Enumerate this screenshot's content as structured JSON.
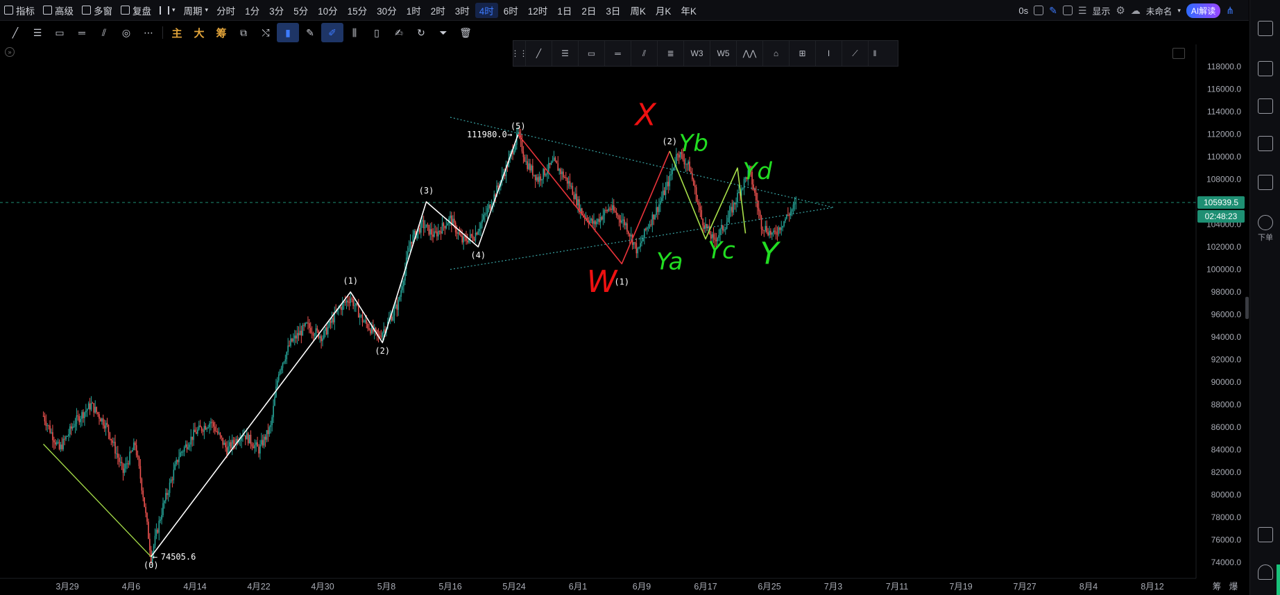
{
  "topbar": {
    "left_items": [
      {
        "name": "indicators",
        "label": "指标",
        "icon": "chart-icon"
      },
      {
        "name": "advanced",
        "label": "高级",
        "icon": "calendar-icon"
      },
      {
        "name": "multi-window",
        "label": "多窗",
        "icon": "grid-icon"
      },
      {
        "name": "replay",
        "label": "复盘",
        "icon": "rewind-icon"
      }
    ],
    "chart_type_icon": "candlestick-icon",
    "period_menu_label": "周期",
    "periods": [
      "分时",
      "1分",
      "3分",
      "5分",
      "10分",
      "15分",
      "30分",
      "1时",
      "2时",
      "3时",
      "4时",
      "6时",
      "12时",
      "1日",
      "2日",
      "3日",
      "周K",
      "月K",
      "年K"
    ],
    "active_period": "4时",
    "right": {
      "timer": "0s",
      "display_label": "显示",
      "layout_name": "未命名",
      "ai_label": "AI解读"
    }
  },
  "toolbar2": {
    "tools": [
      "line-tool-icon",
      "hlines-tool-icon",
      "rect-tool-icon",
      "ruler-tool-icon",
      "parallel-tool-icon",
      "fib-circle-tool-icon",
      "more-tools-icon"
    ],
    "indicator_buttons": [
      "主",
      "大",
      "筹"
    ],
    "extra_tools": [
      "overlay-icon",
      "erase-line-icon",
      "magnet-icon",
      "pencil-icon",
      "draw-active-icon",
      "compare-icon",
      "delete-lock-icon",
      "note-icon",
      "rotate-icon",
      "filter-icon",
      "trash-icon"
    ]
  },
  "floatbar": {
    "tools": [
      "grip-icon",
      "segment-icon",
      "hlines-icon",
      "rect-icon",
      "ruler-icon",
      "parallel-icon",
      "fib-icon",
      "wave3-icon",
      "wave5-icon",
      "peaks-icon",
      "shape-icon",
      "crosshair-icon",
      "text-cursor-icon",
      "pen-icon",
      "collapse-icon"
    ],
    "wave3_label": "W3",
    "wave5_label": "W5"
  },
  "sidebar": {
    "order_label": "下单"
  },
  "colors": {
    "up": "#26a69a",
    "down": "#ef5350",
    "white_wave": "#ffffff",
    "red_wave": "#e8333a",
    "green_wave": "#a8e04a",
    "price_tag": "#1e8f73",
    "annotation_green": "#22dd22",
    "annotation_red": "#ee1111"
  },
  "chart_data": {
    "type": "candlestick",
    "y_ticks": [
      "118000.0",
      "116000.0",
      "114000.0",
      "112000.0",
      "110000.0",
      "108000.0",
      "106000.0",
      "104000.0",
      "102000.0",
      "100000.0",
      "98000.0",
      "96000.0",
      "94000.0",
      "92000.0",
      "90000.0",
      "88000.0",
      "86000.0",
      "84000.0",
      "82000.0",
      "80000.0",
      "78000.0",
      "76000.0",
      "74000.0"
    ],
    "ylim": [
      73000,
      119000
    ],
    "x_ticks": [
      "3月29",
      "4月6",
      "4月14",
      "4月22",
      "4月30",
      "5月8",
      "5月16",
      "5月24",
      "6月1",
      "6月9",
      "6月17",
      "6月25",
      "7月3",
      "7月11",
      "7月19",
      "7月27",
      "8月4",
      "8月12"
    ],
    "x_tick_days": [
      0,
      8,
      16,
      24,
      32,
      40,
      48,
      56,
      64,
      72,
      80,
      88,
      96,
      104,
      112,
      120,
      128,
      136
    ],
    "last_price": "105939.5",
    "last_price_value": 105939.5,
    "countdown": "02:48:23",
    "bottom_right_labels": [
      "筹",
      "爆"
    ],
    "high_label": "111980.0",
    "low_label": "74505.6",
    "high_value": 111980.0,
    "low_value": 74505.6,
    "ohlc_keypoints_day_price": [
      [
        -3,
        87000
      ],
      [
        -1,
        84000
      ],
      [
        1,
        86500
      ],
      [
        3,
        88000
      ],
      [
        5,
        86000
      ],
      [
        7,
        82000
      ],
      [
        8.5,
        84500
      ],
      [
        9.5,
        80000
      ],
      [
        10.5,
        74505.6
      ],
      [
        12,
        79000
      ],
      [
        14,
        83500
      ],
      [
        16,
        85500
      ],
      [
        18,
        86500
      ],
      [
        20,
        84000
      ],
      [
        22,
        85500
      ],
      [
        24,
        84000
      ],
      [
        25.5,
        86000
      ],
      [
        26.5,
        91000
      ],
      [
        28,
        93500
      ],
      [
        30,
        95000
      ],
      [
        32,
        94000
      ],
      [
        34,
        96500
      ],
      [
        35.5,
        97500
      ],
      [
        37,
        95500
      ],
      [
        39,
        94000
      ],
      [
        40,
        95000
      ],
      [
        41.5,
        97000
      ],
      [
        43,
        102500
      ],
      [
        44.5,
        104000
      ],
      [
        46,
        103000
      ],
      [
        48,
        104500
      ],
      [
        49.5,
        102500
      ],
      [
        51,
        103000
      ],
      [
        52.5,
        105000
      ],
      [
        53.5,
        106500
      ],
      [
        55,
        109000
      ],
      [
        56.5,
        111980
      ],
      [
        57.5,
        109500
      ],
      [
        59,
        108000
      ],
      [
        61,
        109500
      ],
      [
        63,
        107500
      ],
      [
        64.5,
        105000
      ],
      [
        66,
        104000
      ],
      [
        68,
        105500
      ],
      [
        70,
        104000
      ],
      [
        71.5,
        101500
      ],
      [
        72.5,
        103500
      ],
      [
        74,
        105500
      ],
      [
        75.5,
        108000
      ],
      [
        76.5,
        110500
      ],
      [
        78,
        109000
      ],
      [
        79.5,
        104500
      ],
      [
        81,
        102500
      ],
      [
        82.5,
        104000
      ],
      [
        84,
        106500
      ],
      [
        85.5,
        108800
      ],
      [
        87,
        104000
      ],
      [
        88.5,
        103000
      ],
      [
        90,
        104500
      ],
      [
        91.5,
        105939.5
      ]
    ],
    "white_wave_points_day_price": [
      [
        10.5,
        74505.6
      ],
      [
        35.5,
        98000
      ],
      [
        39.5,
        93500
      ],
      [
        45,
        106000
      ],
      [
        51.5,
        102000
      ],
      [
        56.5,
        111980
      ]
    ],
    "white_wave_labels": [
      "(0)",
      "(1)",
      "(2)",
      "(3)",
      "(4)",
      "(5)"
    ],
    "red_wave_points_day_price": [
      [
        56.5,
        111980
      ],
      [
        69.5,
        100500
      ],
      [
        75.5,
        110500
      ]
    ],
    "red_wave_labels": [
      "(5)",
      "(1)",
      "(2)"
    ],
    "green_wave_points_day_price": [
      [
        75.5,
        110500
      ],
      [
        80,
        102700
      ],
      [
        84,
        109000
      ],
      [
        85,
        103200
      ]
    ],
    "green_line_left_points_day_price": [
      [
        -3,
        84500
      ],
      [
        10.5,
        74505.6
      ]
    ],
    "triangle_upper_points_day_price": [
      [
        48,
        113500
      ],
      [
        96,
        105500
      ]
    ],
    "triangle_lower_points_day_price": [
      [
        48,
        100000
      ],
      [
        96,
        105500
      ]
    ],
    "annotations": [
      {
        "text": "X",
        "color": "red",
        "day": 72.5,
        "price": 112800
      },
      {
        "text": "W",
        "color": "red",
        "day": 67,
        "price": 98000
      },
      {
        "text": "Yb",
        "color": "green",
        "day": 78.5,
        "price": 110500
      },
      {
        "text": "Yd",
        "color": "green",
        "day": 86.5,
        "price": 108000
      },
      {
        "text": "Ya",
        "color": "green",
        "day": 75.5,
        "price": 100000
      },
      {
        "text": "Yc",
        "color": "green",
        "day": 82,
        "price": 101000
      },
      {
        "text": "Y",
        "color": "green",
        "day": 88,
        "price": 100500
      }
    ]
  }
}
